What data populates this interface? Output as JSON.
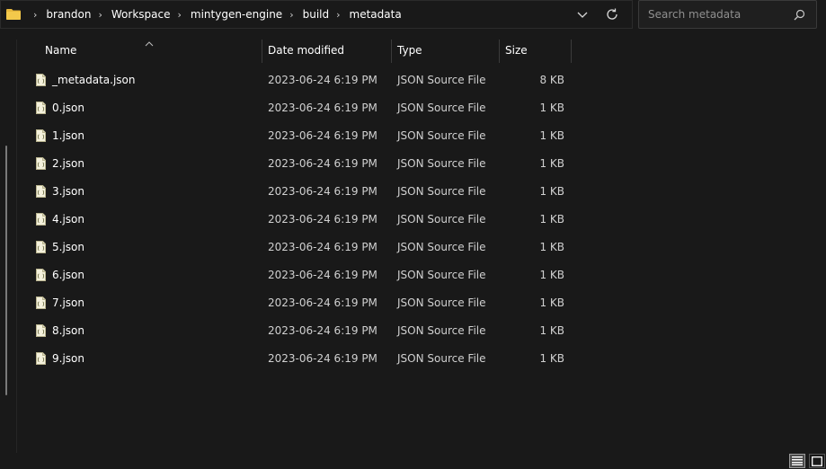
{
  "breadcrumb": {
    "items": [
      "brandon",
      "Workspace",
      "mintygen-engine",
      "build",
      "metadata"
    ],
    "separator": "›"
  },
  "search": {
    "placeholder": "Search metadata"
  },
  "columns": {
    "name": "Name",
    "date": "Date modified",
    "type": "Type",
    "size": "Size"
  },
  "files": [
    {
      "name": "_metadata.json",
      "date": "2023-06-24 6:19 PM",
      "type": "JSON Source File",
      "size": "8 KB"
    },
    {
      "name": "0.json",
      "date": "2023-06-24 6:19 PM",
      "type": "JSON Source File",
      "size": "1 KB"
    },
    {
      "name": "1.json",
      "date": "2023-06-24 6:19 PM",
      "type": "JSON Source File",
      "size": "1 KB"
    },
    {
      "name": "2.json",
      "date": "2023-06-24 6:19 PM",
      "type": "JSON Source File",
      "size": "1 KB"
    },
    {
      "name": "3.json",
      "date": "2023-06-24 6:19 PM",
      "type": "JSON Source File",
      "size": "1 KB"
    },
    {
      "name": "4.json",
      "date": "2023-06-24 6:19 PM",
      "type": "JSON Source File",
      "size": "1 KB"
    },
    {
      "name": "5.json",
      "date": "2023-06-24 6:19 PM",
      "type": "JSON Source File",
      "size": "1 KB"
    },
    {
      "name": "6.json",
      "date": "2023-06-24 6:19 PM",
      "type": "JSON Source File",
      "size": "1 KB"
    },
    {
      "name": "7.json",
      "date": "2023-06-24 6:19 PM",
      "type": "JSON Source File",
      "size": "1 KB"
    },
    {
      "name": "8.json",
      "date": "2023-06-24 6:19 PM",
      "type": "JSON Source File",
      "size": "1 KB"
    },
    {
      "name": "9.json",
      "date": "2023-06-24 6:19 PM",
      "type": "JSON Source File",
      "size": "1 KB"
    }
  ],
  "icons": {
    "folder": "folder-icon",
    "file": "json-file-icon",
    "search": "search-icon",
    "refresh": "refresh-icon",
    "dropdown": "chevron-down-icon"
  },
  "colors": {
    "background": "#191919",
    "folder": "#e8b93c",
    "text": "#ffffff",
    "subtext": "#d0d0d0"
  }
}
